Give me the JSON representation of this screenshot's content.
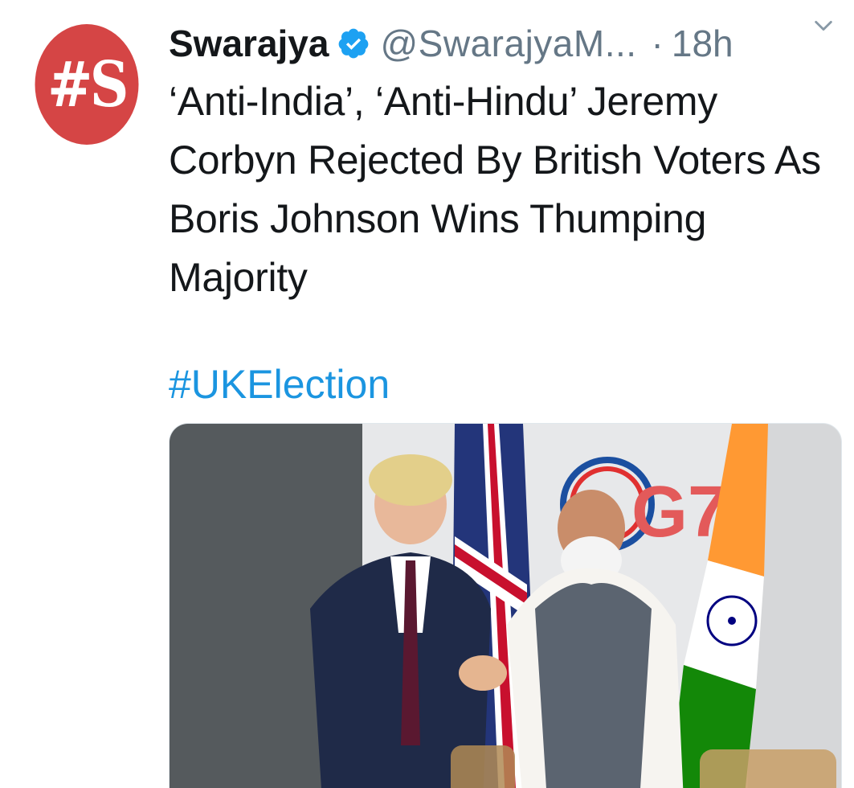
{
  "tweet": {
    "avatar_text": "#S",
    "display_name": "Swarajya",
    "verified_icon": "verified-badge-icon",
    "handle": "@SwarajyaM...",
    "separator": "·",
    "time": "18h",
    "menu_icon": "chevron-down-icon",
    "text": "‘Anti-India’, ‘Anti-Hindu’ Jeremy Corbyn Rejected By British Voters As Boris Johnson Wins Thumping Majority",
    "hashtag": "#UKElection",
    "media_sign_text": "G7",
    "colors": {
      "avatar_bg": "#d54545",
      "verified": "#1da1f2",
      "hashtag": "#1b95e0",
      "secondary_text": "#657786"
    }
  }
}
